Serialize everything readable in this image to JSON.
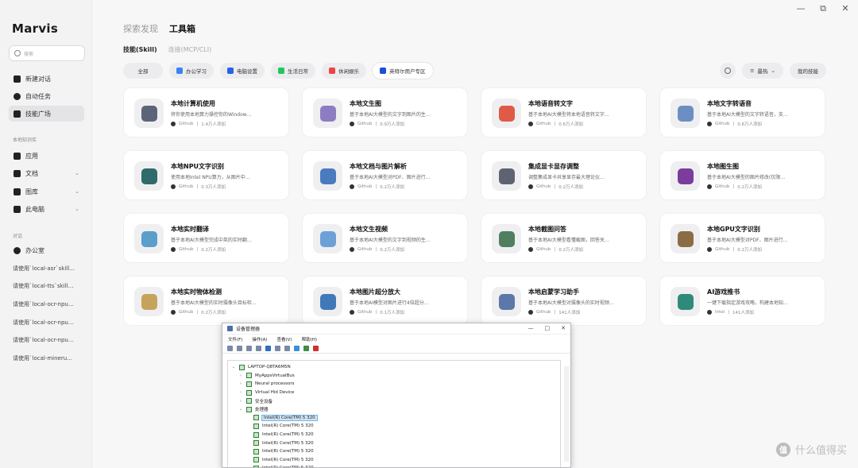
{
  "window": {
    "controls": [
      "—",
      "⧉",
      "✕"
    ]
  },
  "brand": "Marvis",
  "search": {
    "placeholder": "搜索"
  },
  "sidebar": {
    "main_items": [
      {
        "label": "新建对话",
        "icon": "new-chat-icon"
      },
      {
        "label": "自动任务",
        "icon": "clock-icon"
      },
      {
        "label": "技能广场",
        "icon": "wrench-icon"
      }
    ],
    "local_section_title": "本地知识库",
    "local_items": [
      {
        "label": "应用",
        "icon": "apps-icon"
      },
      {
        "label": "文档",
        "icon": "document-icon",
        "chevron": "⌄"
      },
      {
        "label": "图库",
        "icon": "gallery-icon",
        "chevron": "⌄"
      },
      {
        "label": "此电脑",
        "icon": "computer-icon",
        "chevron": "⌄"
      }
    ],
    "conversation_section_title": "对话",
    "conversations": [
      "办公室",
      "请使用`local-asr`skill…",
      "请使用`local-tts`skill…",
      "请使用`local-ocr-npu…",
      "请使用`local-ocr-npu…",
      "请使用`local-ocr-npu…",
      "请使用`local-mineru…"
    ]
  },
  "tabs": [
    "探索发现",
    "工具箱"
  ],
  "subtabs": [
    "技能(Skill)",
    "连接(MCP/CLI)"
  ],
  "filters": [
    {
      "label": "全部"
    },
    {
      "label": "办公学习",
      "color": "#3b82f6"
    },
    {
      "label": "电脑设置",
      "color": "#2563eb"
    },
    {
      "label": "生活日常",
      "color": "#22c55e"
    },
    {
      "label": "休闲娱乐",
      "color": "#ef4444"
    },
    {
      "label": "英特尔用户专区",
      "color": "#1d4ed8"
    }
  ],
  "tools": {
    "sort_label": "最热",
    "sort_chevron": "⌄",
    "my_skills_label": "我的技能"
  },
  "cards": [
    {
      "title": "本地计算机使用",
      "desc": "将你使用本地算力操控你的Window…",
      "source": "Github",
      "users": "1.4万人添加",
      "icon": "gear-icon",
      "color": "#5b6577"
    },
    {
      "title": "本地文生图",
      "desc": "基于本地AI大模型的文字到图片的生…",
      "source": "Github",
      "users": "0.9万人添加",
      "icon": "image-icon",
      "color": "#8e7cc3"
    },
    {
      "title": "本地语音转文字",
      "desc": "基于本地AI大模型将本地语音转文字…",
      "source": "Github",
      "users": "0.6万人添加",
      "icon": "microphone-icon",
      "color": "#e05a47"
    },
    {
      "title": "本地文字转语音",
      "desc": "基于本地AI大模型的文字转语音，支…",
      "source": "Github",
      "users": "0.6万人添加",
      "icon": "megaphone-icon",
      "color": "#6b8fc2"
    },
    {
      "title": "本地NPU文字识别",
      "desc": "使用本地Intel NPU算力，从图片中…",
      "source": "Github",
      "users": "0.3万人添加",
      "icon": "ocr-icon",
      "color": "#2f6b6b"
    },
    {
      "title": "本地文档与图片解析",
      "desc": "基于本地AI大模型对PDF、图片进行…",
      "source": "Github",
      "users": "0.2万人添加",
      "icon": "document-parse-icon",
      "color": "#4a7bbf"
    },
    {
      "title": "集成显卡显存调整",
      "desc": "调整集成显卡共享显存最大理论仪…",
      "source": "Github",
      "users": "0.2万人添加",
      "icon": "memory-chip-icon",
      "color": "#5d6370"
    },
    {
      "title": "本地图生图",
      "desc": "基于本地AI大模型的图片修改(仅限…",
      "source": "Github",
      "users": "0.2万人添加",
      "icon": "image-edit-icon",
      "color": "#7a3d9b"
    },
    {
      "title": "本地实时翻译",
      "desc": "基于本地AI大模型完成中英的实时翻…",
      "source": "Github",
      "users": "0.2万人添加",
      "icon": "translate-icon",
      "color": "#5a9fc9"
    },
    {
      "title": "本地文生视频",
      "desc": "基于本地AI大模型的文字到视频的生…",
      "source": "Github",
      "users": "0.2万人添加",
      "icon": "video-icon",
      "color": "#6ea0d8"
    },
    {
      "title": "本地截图问答",
      "desc": "基于本地AI大模型看懂截图，回答关…",
      "source": "Github",
      "users": "0.2万人添加",
      "icon": "screenshot-search-icon",
      "color": "#4f7f5e"
    },
    {
      "title": "本地GPU文字识别",
      "desc": "基于本地AI大模型对PDF、图片进行…",
      "source": "Github",
      "users": "0.2万人添加",
      "icon": "gpu-ocr-icon",
      "color": "#8a6d45"
    },
    {
      "title": "本地实时物体检测",
      "desc": "基于本地AI大模型的实时摄像头目标检…",
      "source": "Github",
      "users": "0.2万人添加",
      "icon": "face-detect-icon",
      "color": "#c6a35c"
    },
    {
      "title": "本地图片超分放大",
      "desc": "基于本地AI模型对图片进行4倍超分…",
      "source": "Github",
      "users": "0.1万人添加",
      "icon": "zoom-image-icon",
      "color": "#3f79b8"
    },
    {
      "title": "本地启蒙学习助手",
      "desc": "基于本地AI大模型对摄像头的实时视频…",
      "source": "Github",
      "users": "141人添加",
      "icon": "learning-icon",
      "color": "#5b78a8"
    },
    {
      "title": "AI游戏推书",
      "desc": "一键下载指定游戏攻略，构建本地知…",
      "source": "Intel",
      "users": "141人添加",
      "icon": "gamepad-icon",
      "color": "#2f8a7a"
    }
  ],
  "device_manager": {
    "title": "设备管理器",
    "controls": [
      "—",
      "□",
      "✕"
    ],
    "menu": [
      "文件(F)",
      "操作(A)",
      "查看(V)",
      "帮助(H)"
    ],
    "tree": [
      {
        "label": "LAPTOP-Q8TA6M5N",
        "indent": 0,
        "arrow": "⌄"
      },
      {
        "label": "MyAppsVirtualBus",
        "indent": 1,
        "arrow": "›"
      },
      {
        "label": "Neural processors",
        "indent": 1,
        "arrow": "›"
      },
      {
        "label": "Virtual Hid Device",
        "indent": 1,
        "arrow": "›"
      },
      {
        "label": "安全设备",
        "indent": 1,
        "arrow": "›"
      },
      {
        "label": "处理器",
        "indent": 1,
        "arrow": "⌄"
      },
      {
        "label": "Intel(R) Core(TM) 5 320",
        "indent": 2,
        "arrow": "",
        "selected": true
      },
      {
        "label": "Intel(R) Core(TM) 5 320",
        "indent": 2,
        "arrow": ""
      },
      {
        "label": "Intel(R) Core(TM) 5 320",
        "indent": 2,
        "arrow": ""
      },
      {
        "label": "Intel(R) Core(TM) 5 320",
        "indent": 2,
        "arrow": ""
      },
      {
        "label": "Intel(R) Core(TM) 5 320",
        "indent": 2,
        "arrow": ""
      },
      {
        "label": "Intel(R) Core(TM) 5 320",
        "indent": 2,
        "arrow": ""
      },
      {
        "label": "Intel(R) Core(TM) 5 320",
        "indent": 2,
        "arrow": ""
      }
    ]
  },
  "watermark": {
    "badge": "值",
    "text": "什么值得买"
  }
}
